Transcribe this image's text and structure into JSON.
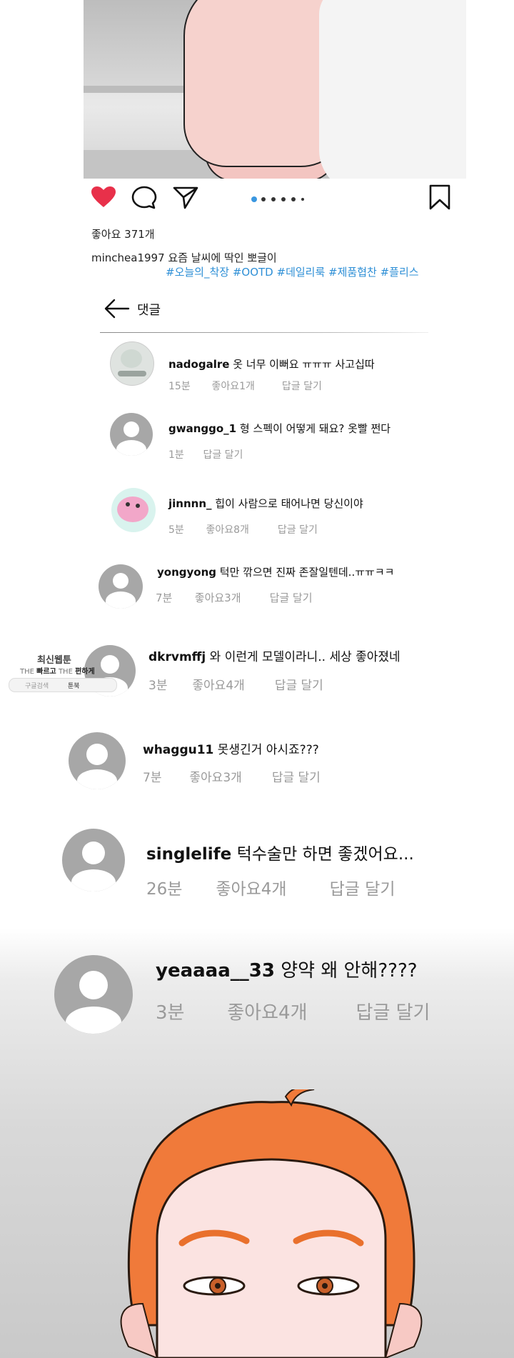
{
  "post": {
    "likes_text": "좋아요 371개",
    "caption_user": "minchea1997",
    "caption_text": "요즘 날씨에 딱인 뽀글이",
    "hashtags": "#오늘의_착장 #OOTD #데일리룩 #제품협찬 #플리스",
    "carousel_count": 6,
    "carousel_active_index": 0,
    "liked": true,
    "heart_color": "#e8304a",
    "hashtag_color": "#2e8fd6"
  },
  "comments_panel": {
    "title": "댓글",
    "back_icon": "arrow-left-icon"
  },
  "comments": [
    {
      "user": "nadogalre",
      "text": "옷 너무 이뻐요 ㅠㅠㅠ 사고십따",
      "time": "15분",
      "likes": "좋아요1개",
      "reply": "답글 달기",
      "avatar": "photo"
    },
    {
      "user": "gwanggo_1",
      "text": "형 스펙이 어떻게 돼요? 옷빨 쩐다",
      "time": "1분",
      "likes": "",
      "reply": "답글 달기",
      "avatar": "default"
    },
    {
      "user": "jinnnn_",
      "text": "힙이 사람으로 태어나면 당신이야",
      "time": "5분",
      "likes": "좋아요8개",
      "reply": "답글 달기",
      "avatar": "pink"
    },
    {
      "user": "yongyong",
      "text": "턱만 깎으면 진짜 존잘일텐데..ㅠㅠㅋㅋ",
      "time": "7분",
      "likes": "좋아요3개",
      "reply": "답글 달기",
      "avatar": "default"
    },
    {
      "user": "dkrvmffj",
      "text": "와 이런게 모델이라니.. 세상 좋아졌네",
      "time": "3분",
      "likes": "좋아요4개",
      "reply": "답글 달기",
      "avatar": "default"
    },
    {
      "user": "whaggu11",
      "text": "못생긴거 아시죠???",
      "time": "7분",
      "likes": "좋아요3개",
      "reply": "답글 달기",
      "avatar": "default"
    },
    {
      "user": "singlelife",
      "text": "턱수술만 하면 좋겠어요...",
      "time": "26분",
      "likes": "좋아요4개",
      "reply": "답글 달기",
      "avatar": "default"
    },
    {
      "user": "yeaaaa__33",
      "text": "양약 왜 안해????",
      "time": "3분",
      "likes": "좋아요4개",
      "reply": "답글 달기",
      "avatar": "default"
    }
  ],
  "watermark": {
    "title": "최신웹툰",
    "sub_the1": "THE",
    "sub_fast": "빠르고",
    "sub_the2": "THE",
    "sub_easy": "편하게",
    "search_label": "구글검색",
    "brand": "툰북"
  }
}
